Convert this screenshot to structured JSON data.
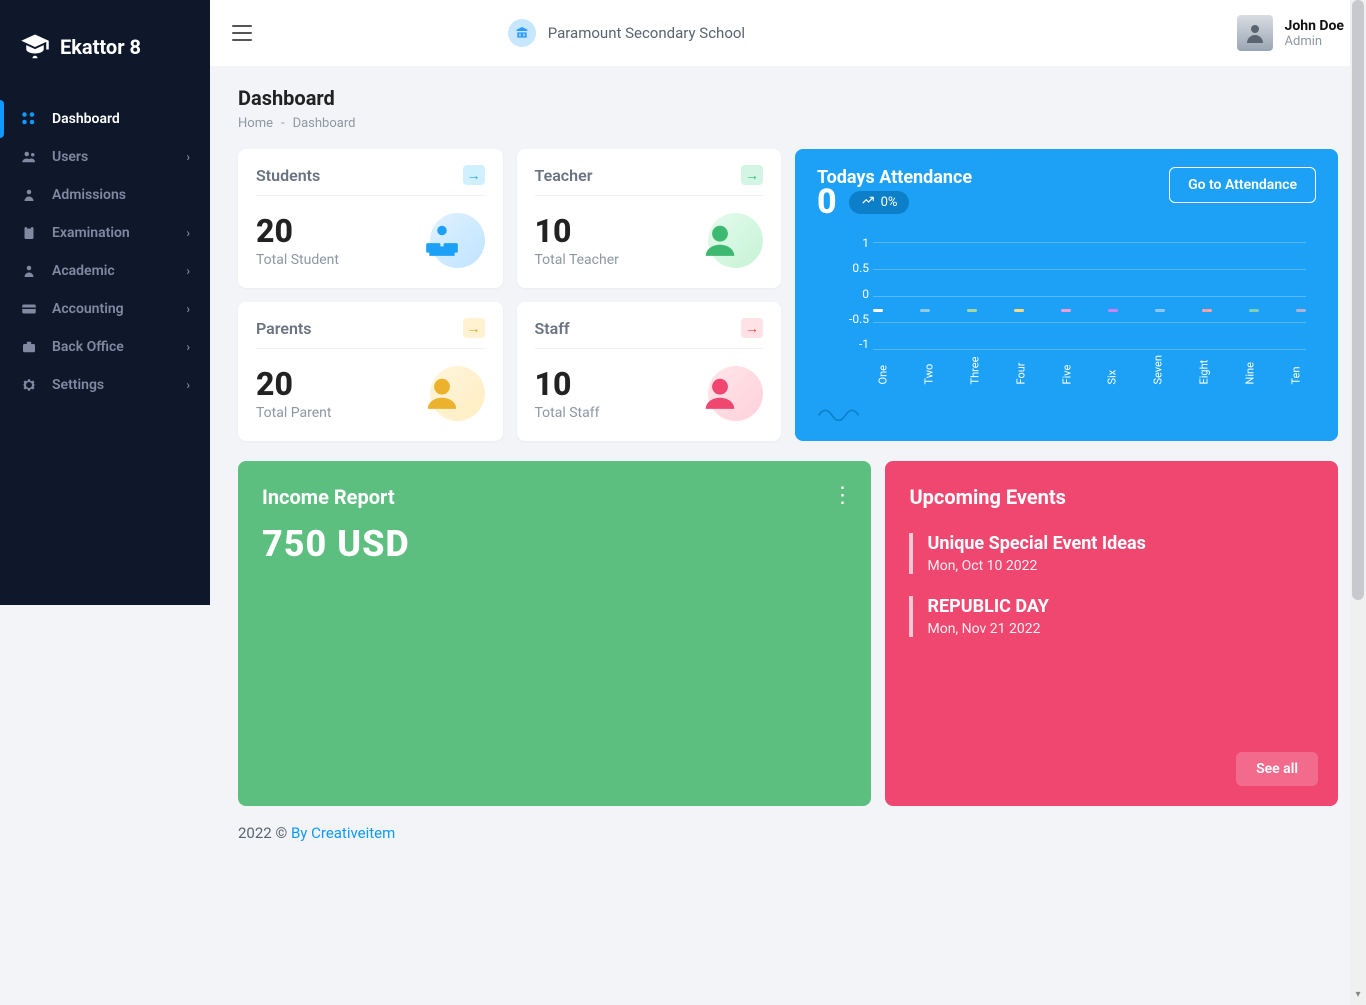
{
  "app": {
    "name": "Ekattor 8"
  },
  "sidebar": {
    "items": [
      {
        "label": "Dashboard",
        "has_children": false,
        "active": true
      },
      {
        "label": "Users",
        "has_children": true
      },
      {
        "label": "Admissions",
        "has_children": false
      },
      {
        "label": "Examination",
        "has_children": true
      },
      {
        "label": "Academic",
        "has_children": true
      },
      {
        "label": "Accounting",
        "has_children": true
      },
      {
        "label": "Back Office",
        "has_children": true
      },
      {
        "label": "Settings",
        "has_children": true
      }
    ]
  },
  "topbar": {
    "school_name": "Paramount Secondary School",
    "user_name": "John Doe",
    "user_role": "Admin"
  },
  "page": {
    "title": "Dashboard",
    "breadcrumb_home": "Home",
    "breadcrumb_current": "Dashboard"
  },
  "stats": {
    "students": {
      "title": "Students",
      "value": "20",
      "subtitle": "Total Student"
    },
    "teachers": {
      "title": "Teacher",
      "value": "10",
      "subtitle": "Total Teacher"
    },
    "parents": {
      "title": "Parents",
      "value": "20",
      "subtitle": "Total Parent"
    },
    "staff": {
      "title": "Staff",
      "value": "10",
      "subtitle": "Total Staff"
    }
  },
  "attendance": {
    "title": "Todays Attendance",
    "button": "Go to Attendance",
    "value": "0",
    "pct": "0%"
  },
  "income": {
    "title": "Income Report",
    "value": "750 USD"
  },
  "events": {
    "title": "Upcoming Events",
    "list": [
      {
        "name": "Unique Special Event Ideas",
        "date": "Mon, Oct 10 2022"
      },
      {
        "name": "REPUBLIC DAY",
        "date": "Mon, Nov 21 2022"
      }
    ],
    "see_all": "See all"
  },
  "footer": {
    "year_text": "2022 © ",
    "link_text": "By Creativeitem"
  },
  "chart_data": {
    "type": "line",
    "title": "Todays Attendance",
    "categories": [
      "One",
      "Two",
      "Three",
      "Four",
      "Five",
      "Six",
      "Seven",
      "Eight",
      "Nine",
      "Ten"
    ],
    "values": [
      0,
      0,
      0,
      0,
      0,
      0,
      0,
      0,
      0,
      0
    ],
    "ylim": [
      -1.0,
      1.0
    ],
    "yticks": [
      1.0,
      0.5,
      0,
      -0.5,
      -1.0
    ],
    "xlabel": "",
    "ylabel": ""
  },
  "colors": {
    "sidebar_bg": "#0f172a",
    "accent_blue": "#1da1f7",
    "accent_green": "#5cbf7f",
    "accent_pink": "#f04770",
    "link_blue": "#0d99ff"
  }
}
